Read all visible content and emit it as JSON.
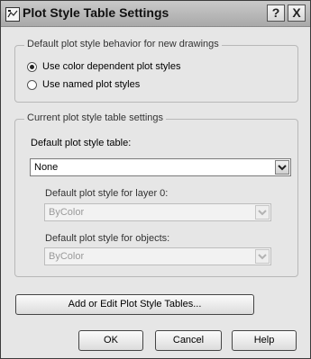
{
  "window": {
    "title": "Plot Style Table Settings",
    "help_glyph": "?",
    "close_glyph": "X"
  },
  "behavior_group": {
    "title": "Default plot style behavior for new drawings",
    "options": [
      {
        "label": "Use color dependent plot styles",
        "selected": true
      },
      {
        "label": "Use named plot styles",
        "selected": false
      }
    ]
  },
  "current_group": {
    "title": "Current plot style table settings",
    "table_label": "Default plot style table:",
    "table_value": "None",
    "layer0_label": "Default plot style for layer 0:",
    "layer0_value": "ByColor",
    "objects_label": "Default plot style for objects:",
    "objects_value": "ByColor"
  },
  "buttons": {
    "add_edit": "Add or Edit Plot Style Tables...",
    "ok": "OK",
    "cancel": "Cancel",
    "help": "Help"
  },
  "icons": {
    "app": "plot-style-table-icon",
    "dropdown": "chevron-down-icon"
  }
}
